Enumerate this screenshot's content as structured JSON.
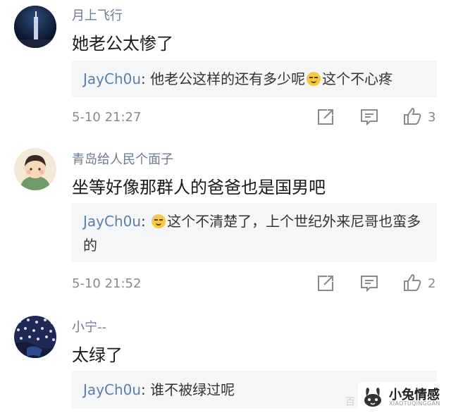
{
  "comments": [
    {
      "username": "月上飞行",
      "content": "她老公太惨了",
      "reply": {
        "author": "JayCh0u",
        "text_before": "他老公这样的还有多少呢",
        "text_after": "这个不心疼"
      },
      "time": "5-10 21:27",
      "likes": "3"
    },
    {
      "username": "青岛给人民个面子",
      "content": "坐等好像那群人的爸爸也是国男吧",
      "reply": {
        "author": "JayCh0u",
        "text_line1": "这个不清楚了，上个世纪外来尼哥也蛮多",
        "text_line2": "的"
      },
      "time": "5-10 21:52",
      "likes": "2"
    },
    {
      "username": "小宁--",
      "content": "太绿了",
      "reply": {
        "author": "JayCh0u",
        "text": "谁不被绿过呢"
      }
    }
  ],
  "reply_separator": ": ",
  "icons": [
    "share-icon",
    "comment-icon",
    "like-icon",
    "smile-emoji"
  ],
  "watermark": {
    "title": "小兔情感",
    "subtitle": "XIAOTUQINGGAN",
    "left_text": "百"
  },
  "colors": {
    "username": "#6e7a8f",
    "reply_author": "#5b7fa6",
    "reply_bg": "#f5f6f7",
    "meta": "#8a8a8a"
  }
}
